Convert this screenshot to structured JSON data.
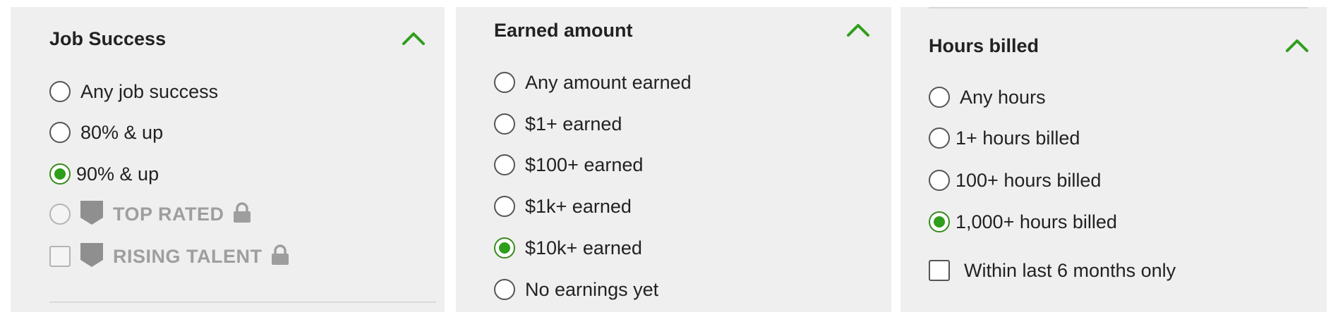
{
  "colors": {
    "accent_green": "#2f9e1b",
    "panel_background": "#efefef",
    "disabled_text": "#9e9e9e"
  },
  "job_success": {
    "title": "Job Success",
    "toggle_icon": "chevron-up-icon",
    "options": [
      {
        "label": "Any job success",
        "type": "radio",
        "selected": false
      },
      {
        "label": "80% & up",
        "type": "radio",
        "selected": false
      },
      {
        "label": "90% & up",
        "type": "radio",
        "selected": true
      },
      {
        "label": "TOP RATED",
        "type": "radio",
        "selected": false,
        "disabled": true,
        "icons": [
          "badge-icon",
          "lock-icon"
        ]
      },
      {
        "label": "RISING TALENT",
        "type": "checkbox",
        "checked": false,
        "disabled": true,
        "icons": [
          "badge-icon",
          "lock-icon"
        ]
      }
    ]
  },
  "earned_amount": {
    "title": "Earned amount",
    "toggle_icon": "chevron-up-icon",
    "options": [
      {
        "label": "Any amount earned",
        "type": "radio",
        "selected": false
      },
      {
        "label": "$1+ earned",
        "type": "radio",
        "selected": false
      },
      {
        "label": "$100+ earned",
        "type": "radio",
        "selected": false
      },
      {
        "label": "$1k+ earned",
        "type": "radio",
        "selected": false
      },
      {
        "label": "$10k+ earned",
        "type": "radio",
        "selected": true
      },
      {
        "label": "No earnings yet",
        "type": "radio",
        "selected": false
      }
    ]
  },
  "hours_billed": {
    "title": "Hours billed",
    "toggle_icon": "chevron-up-icon",
    "options": [
      {
        "label": "Any hours",
        "type": "radio",
        "selected": false
      },
      {
        "label": "1+ hours billed",
        "type": "radio",
        "selected": false
      },
      {
        "label": "100+ hours billed",
        "type": "radio",
        "selected": false
      },
      {
        "label": "1,000+ hours billed",
        "type": "radio",
        "selected": true
      }
    ],
    "recent_filter": {
      "label": "Within last 6 months only",
      "type": "checkbox",
      "checked": false
    }
  }
}
